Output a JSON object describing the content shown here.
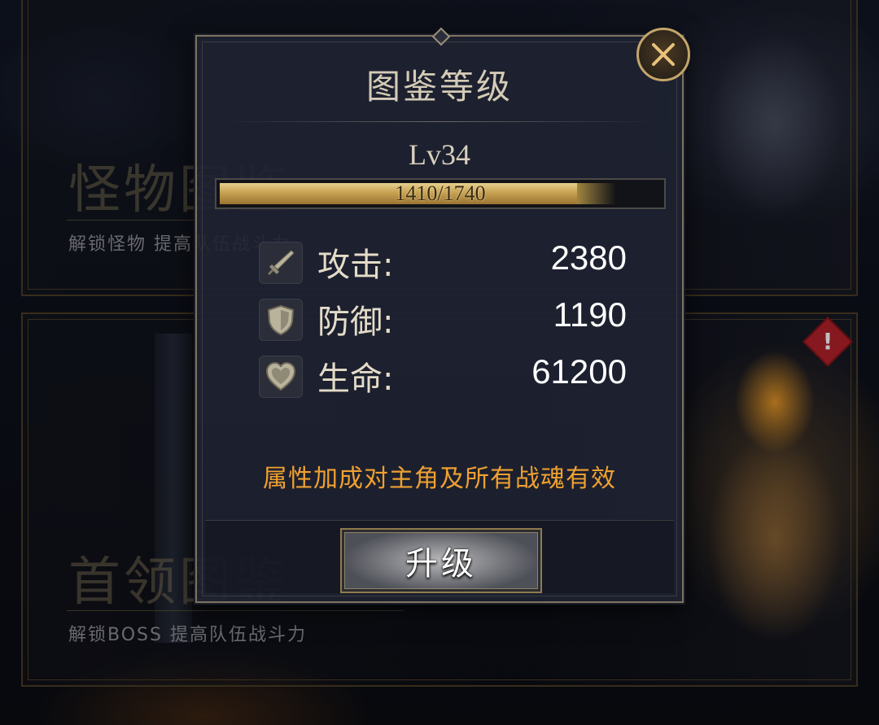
{
  "background": {
    "monster_card": {
      "title": "怪物图鉴",
      "subtitle": "解锁怪物 提高队伍战斗力"
    },
    "boss_card": {
      "title": "首领图鉴",
      "subtitle": "解锁BOSS 提高队伍战斗力",
      "alert_mark": "!"
    }
  },
  "dialog": {
    "title": "图鉴等级",
    "level": "Lv34",
    "xp": {
      "current": 1410,
      "max": 1740,
      "text": "1410/1740"
    },
    "stats": [
      {
        "icon": "sword-icon",
        "label": "攻击:",
        "value": "2380"
      },
      {
        "icon": "shield-icon",
        "label": "防御:",
        "value": "1190"
      },
      {
        "icon": "heart-icon",
        "label": "生命:",
        "value": "61200"
      }
    ],
    "note": "属性加成对主角及所有战魂有效",
    "upgrade_button": "升级",
    "close_icon": "close-icon"
  },
  "colors": {
    "note": "#f0a030",
    "xp_fill": "#c7a252",
    "close_ring": "#c3a56b",
    "alert": "#b3202a"
  }
}
